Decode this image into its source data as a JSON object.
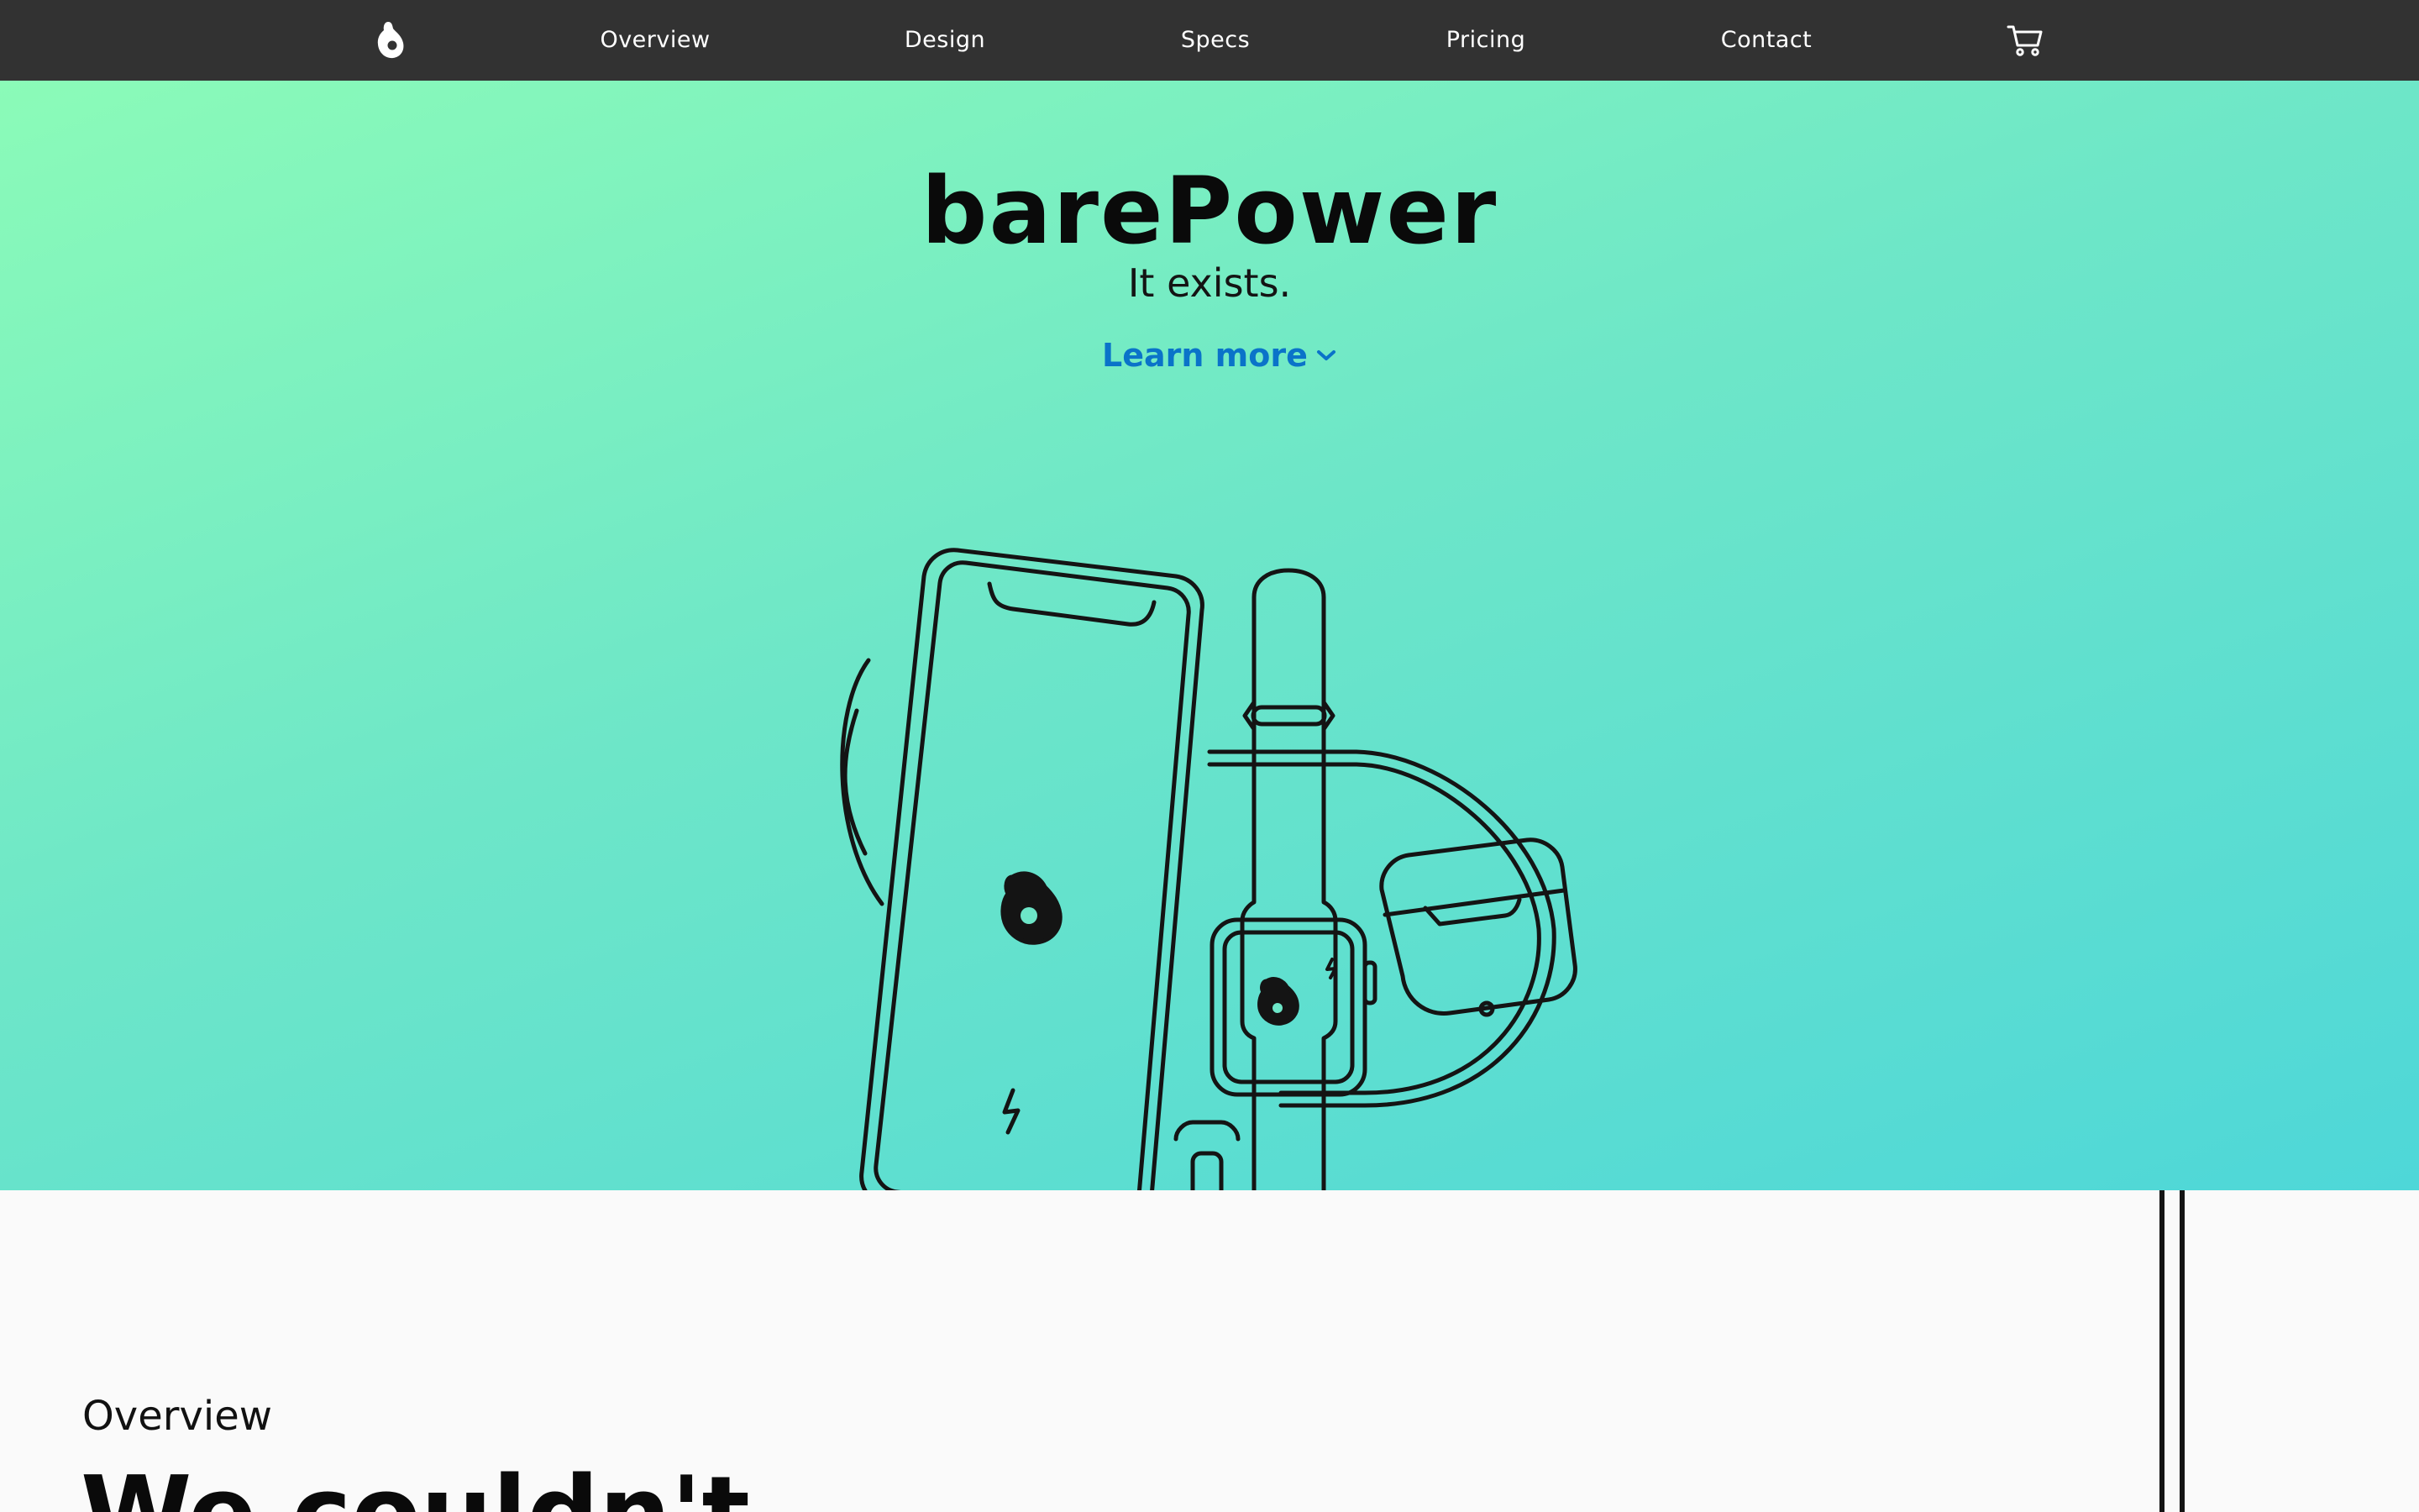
{
  "nav": {
    "logo_icon": "avocado-logo-icon",
    "links": [
      {
        "label": "Overview"
      },
      {
        "label": "Design"
      },
      {
        "label": "Specs"
      },
      {
        "label": "Pricing"
      },
      {
        "label": "Contact"
      }
    ],
    "cart_icon": "shopping-cart-icon"
  },
  "hero": {
    "title": "barePower",
    "subtitle": "It exists.",
    "cta_label": "Learn more",
    "cta_icon": "chevron-down-icon",
    "illustration": "wireless-charger-with-phone-watch-earbuds"
  },
  "overview": {
    "label": "Overview",
    "headline": "We couldn't"
  },
  "colors": {
    "nav_bg": "#323232",
    "gradient_start": "#8bfbb8",
    "gradient_end": "#4ed7d8",
    "link_blue": "#0a73c9",
    "outline": "#141414"
  }
}
